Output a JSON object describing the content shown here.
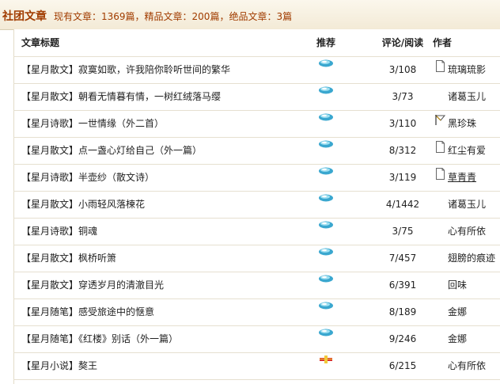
{
  "header": {
    "title": "社团文章",
    "stats": "现有文章：1369篇，精品文章：200篇，绝品文章：3篇"
  },
  "columns": {
    "title": "文章标题",
    "recommend": "推荐",
    "count": "评论/阅读",
    "author": "作者"
  },
  "rows": [
    {
      "title": "【星月散文】寂寞如歌，许我陪你聆听世间的繁华",
      "rec_icon": "gem-icon",
      "count": "3/108",
      "author": "琉璃琉影",
      "author_icon": "document-icon"
    },
    {
      "title": "【星月散文】朝看无情暮有情，一树红绒落马缨",
      "rec_icon": "gem-icon",
      "count": "3/73",
      "author": "诸葛玉儿",
      "author_icon": ""
    },
    {
      "title": "【星月诗歌】一世情缘（外二首）",
      "rec_icon": "gem-icon",
      "count": "3/110",
      "author": "黑珍珠",
      "author_icon": "flag-icon"
    },
    {
      "title": "【星月散文】点一盏心灯给自己（外一篇）",
      "rec_icon": "gem-icon",
      "count": "8/312",
      "author": "红尘有爱",
      "author_icon": "document-icon"
    },
    {
      "title": "【星月诗歌】半壶纱（散文诗）",
      "rec_icon": "gem-icon",
      "count": "3/119",
      "author": "草青青",
      "author_icon": "document-icon",
      "author_underline": true
    },
    {
      "title": "【星月散文】小雨轻风落楝花",
      "rec_icon": "gem-icon",
      "count": "4/1442",
      "author": "诸葛玉儿",
      "author_icon": ""
    },
    {
      "title": "【星月诗歌】铜魂",
      "rec_icon": "gem-icon",
      "count": "3/75",
      "author": "心有所依",
      "author_icon": ""
    },
    {
      "title": "【星月散文】枫桥听箫",
      "rec_icon": "gem-icon",
      "count": "7/457",
      "author": "翅膀的痕迹",
      "author_icon": ""
    },
    {
      "title": "【星月散文】穿透岁月的清澈目光",
      "rec_icon": "gem-icon",
      "count": "6/391",
      "author": "回味",
      "author_icon": ""
    },
    {
      "title": "【星月随笔】感受旅途中的惬意",
      "rec_icon": "gem-icon",
      "count": "8/189",
      "author": "金娜",
      "author_icon": ""
    },
    {
      "title": "【星月随笔】《红楼》别话（外一篇）",
      "rec_icon": "gem-icon",
      "count": "9/246",
      "author": "金娜",
      "author_icon": ""
    },
    {
      "title": "【星月小说】獒王",
      "rec_icon": "ribbon-icon",
      "count": "6/215",
      "author": "心有所依",
      "author_icon": ""
    }
  ]
}
